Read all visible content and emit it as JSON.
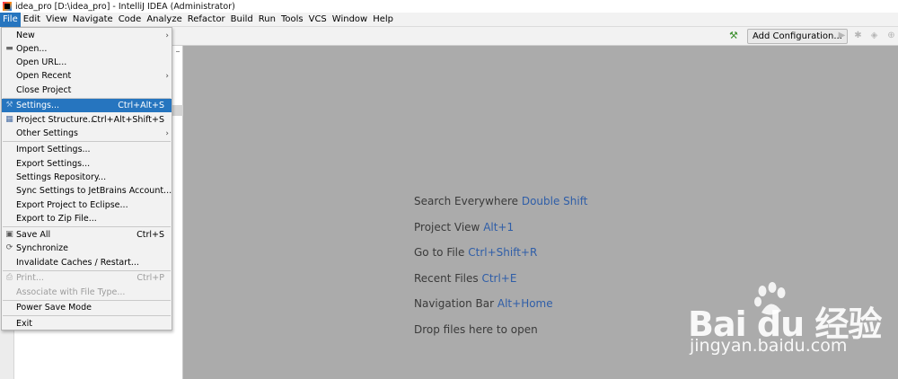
{
  "window": {
    "title": "idea_pro [D:\\idea_pro] - IntelliJ IDEA (Administrator)"
  },
  "menubar": {
    "items": [
      "File",
      "Edit",
      "View",
      "Navigate",
      "Code",
      "Analyze",
      "Refactor",
      "Build",
      "Run",
      "Tools",
      "VCS",
      "Window",
      "Help"
    ]
  },
  "toolbar": {
    "add_configuration_label": "Add Configuration..."
  },
  "file_menu": {
    "items": [
      {
        "label": "New",
        "shortcut": "",
        "submenu": true,
        "icon": ""
      },
      {
        "label": "Open...",
        "shortcut": "",
        "submenu": false,
        "icon": "folder-icon"
      },
      {
        "label": "Open URL...",
        "shortcut": "",
        "submenu": false,
        "icon": ""
      },
      {
        "label": "Open Recent",
        "shortcut": "",
        "submenu": true,
        "icon": ""
      },
      {
        "label": "Close Project",
        "shortcut": "",
        "submenu": false,
        "icon": ""
      },
      {
        "label": "Settings...",
        "shortcut": "Ctrl+Alt+S",
        "submenu": false,
        "icon": "wrench-icon",
        "selected": true
      },
      {
        "label": "Project Structure...",
        "shortcut": "Ctrl+Alt+Shift+S",
        "submenu": false,
        "icon": "project-structure-icon"
      },
      {
        "label": "Other Settings",
        "shortcut": "",
        "submenu": true,
        "icon": ""
      },
      {
        "label": "Import Settings...",
        "shortcut": "",
        "submenu": false,
        "icon": ""
      },
      {
        "label": "Export Settings...",
        "shortcut": "",
        "submenu": false,
        "icon": ""
      },
      {
        "label": "Settings Repository...",
        "shortcut": "",
        "submenu": false,
        "icon": ""
      },
      {
        "label": "Sync Settings to JetBrains Account...",
        "shortcut": "",
        "submenu": false,
        "icon": ""
      },
      {
        "label": "Export Project to Eclipse...",
        "shortcut": "",
        "submenu": false,
        "icon": ""
      },
      {
        "label": "Export to Zip File...",
        "shortcut": "",
        "submenu": false,
        "icon": ""
      },
      {
        "label": "Save All",
        "shortcut": "Ctrl+S",
        "submenu": false,
        "icon": "save-icon"
      },
      {
        "label": "Synchronize",
        "shortcut": "",
        "submenu": false,
        "icon": "sync-icon"
      },
      {
        "label": "Invalidate Caches / Restart...",
        "shortcut": "",
        "submenu": false,
        "icon": ""
      },
      {
        "label": "Print...",
        "shortcut": "Ctrl+P",
        "submenu": false,
        "icon": "print-icon",
        "disabled": true
      },
      {
        "label": "Associate with File Type...",
        "shortcut": "",
        "submenu": false,
        "icon": "",
        "disabled": true
      },
      {
        "label": "Power Save Mode",
        "shortcut": "",
        "submenu": false,
        "icon": ""
      },
      {
        "label": "Exit",
        "shortcut": "",
        "submenu": false,
        "icon": ""
      }
    ]
  },
  "welcome_hints": [
    {
      "label": "Search Everywhere",
      "shortcut": "Double Shift"
    },
    {
      "label": "Project View",
      "shortcut": "Alt+1"
    },
    {
      "label": "Go to File",
      "shortcut": "Ctrl+Shift+R"
    },
    {
      "label": "Recent Files",
      "shortcut": "Ctrl+E"
    },
    {
      "label": "Navigation Bar",
      "shortcut": "Alt+Home"
    },
    {
      "label": "Drop files here to open",
      "shortcut": ""
    }
  ],
  "watermark": {
    "brand": "Bai du 经验",
    "url": "jingyan.baidu.com"
  },
  "colors": {
    "menu_selection": "#2675bf",
    "shortcut_link": "#2f5ea8",
    "editor_background": "#ababab"
  }
}
